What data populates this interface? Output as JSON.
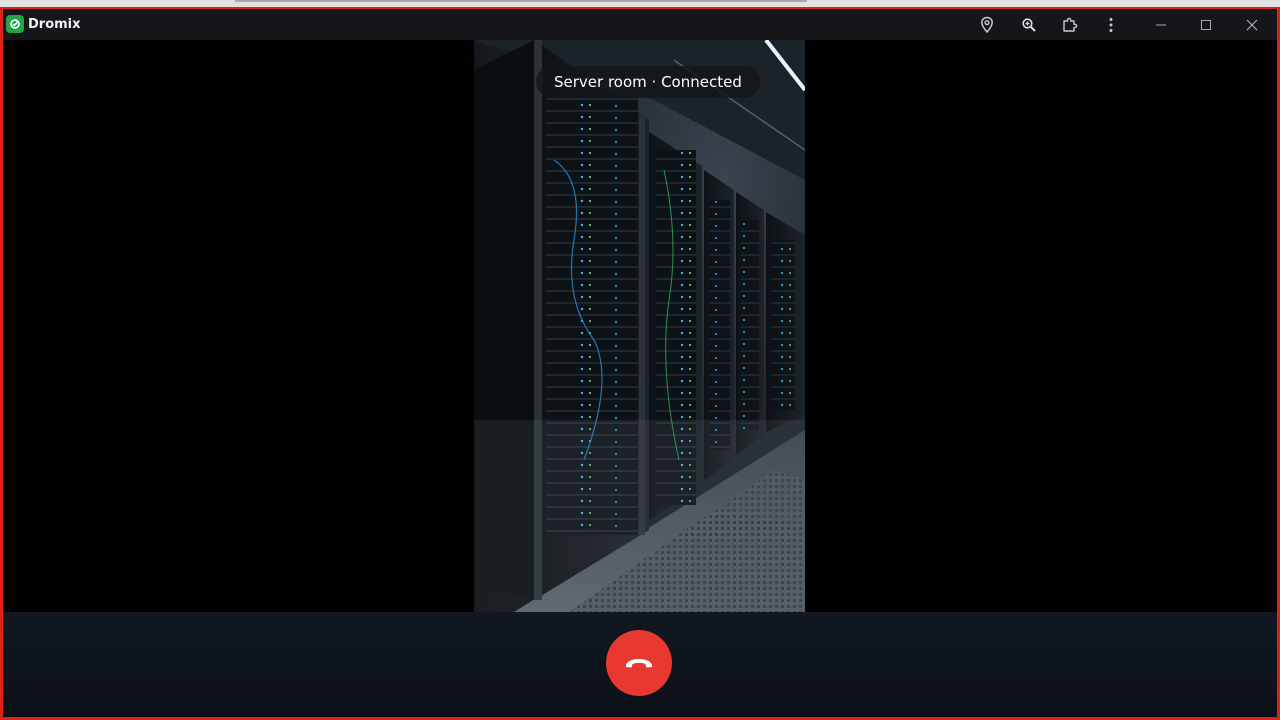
{
  "window": {
    "title": "Dromix",
    "border_color": "#e0201b",
    "logo_color": "#22a546",
    "toolbar_icons": [
      "location-pin-icon",
      "zoom-in-icon",
      "extension-puzzle-icon",
      "more-vertical-icon"
    ],
    "window_controls": [
      "minimize-icon",
      "maximize-icon",
      "close-icon"
    ]
  },
  "call": {
    "status": "Server room · Connected",
    "hangup_color": "#e8382f",
    "hangup_icon": "phone-hangup-icon"
  }
}
